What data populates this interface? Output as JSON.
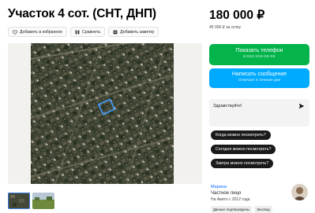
{
  "listing": {
    "title": "Участок 4 сот. (СНТ, ДНП)",
    "actions": [
      {
        "label": "Добавить в избранное",
        "icon": "heart-icon"
      },
      {
        "label": "Сравнить",
        "icon": "compare-icon"
      },
      {
        "label": "Добавить заметку",
        "icon": "note-icon"
      }
    ]
  },
  "price": {
    "value": "180 000 ₽",
    "per_unit": "45 000 ₽ за сотку"
  },
  "contact": {
    "phone_button": {
      "label": "Показать телефон",
      "sub": "8 XXX XXX-XX-XX"
    },
    "message_button": {
      "label": "Написать сообщение",
      "sub": "Отвечает в течение дня"
    }
  },
  "chat": {
    "placeholder": "Здравствуйте!",
    "send_icon": "send-icon",
    "quick_questions": [
      "Когда можно посмотреть?",
      "Сегодня можно посмотреть?",
      "Завтра можно посмотреть?"
    ]
  },
  "seller": {
    "name": "Марина",
    "type": "Частное лицо",
    "since": "На Авито с 2012 года",
    "badges": [
      "Данные подтверждены",
      "Экосвод"
    ]
  },
  "colors": {
    "green": "#04b44b",
    "blue": "#00aaff",
    "link": "#0a6cff",
    "marker": "#3c9bff"
  },
  "gallery": {
    "count": 2,
    "selected_index": 0
  }
}
